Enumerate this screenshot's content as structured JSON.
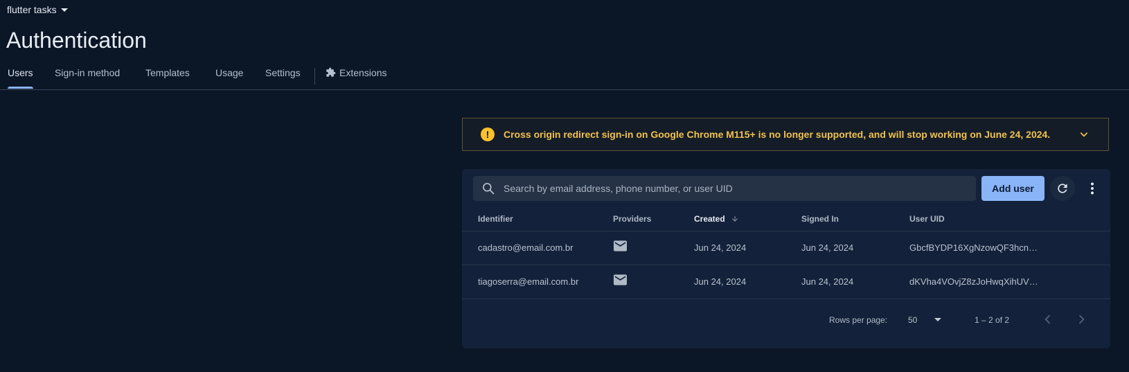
{
  "project": {
    "name": "flutter tasks"
  },
  "page": {
    "title": "Authentication"
  },
  "tabs": [
    {
      "label": "Users",
      "active": true
    },
    {
      "label": "Sign-in method",
      "active": false
    },
    {
      "label": "Templates",
      "active": false
    },
    {
      "label": "Usage",
      "active": false
    },
    {
      "label": "Settings",
      "active": false
    },
    {
      "label": "Extensions",
      "active": false,
      "icon": "puzzle-icon"
    }
  ],
  "banner": {
    "icon": "warning-icon",
    "text": "Cross origin redirect sign-in on Google Chrome M115+ is no longer supported, and will stop working on June 24, 2024.",
    "color": "#f2c24e"
  },
  "toolbar": {
    "search_placeholder": "Search by email address, phone number, or user UID",
    "add_user_label": "Add user",
    "accent": "#8ab4f8"
  },
  "table": {
    "columns": [
      "Identifier",
      "Providers",
      "Created",
      "Signed In",
      "User UID"
    ],
    "sorted_column": "Created",
    "sort_direction": "descending",
    "rows": [
      {
        "identifier": "cadastro@email.com.br",
        "provider": "mail-icon",
        "created": "Jun 24, 2024",
        "signed_in": "Jun 24, 2024",
        "uid": "GbcfBYDP16XgNzowQF3hcnf..."
      },
      {
        "identifier": "tiagoserra@email.com.br",
        "provider": "mail-icon",
        "created": "Jun 24, 2024",
        "signed_in": "Jun 24, 2024",
        "uid": "dKVha4VOvjZ8zJoHwqXihUVg..."
      }
    ]
  },
  "pagination": {
    "rows_per_page_label": "Rows per page:",
    "rows_per_page": "50",
    "range": "1 – 2 of 2"
  }
}
